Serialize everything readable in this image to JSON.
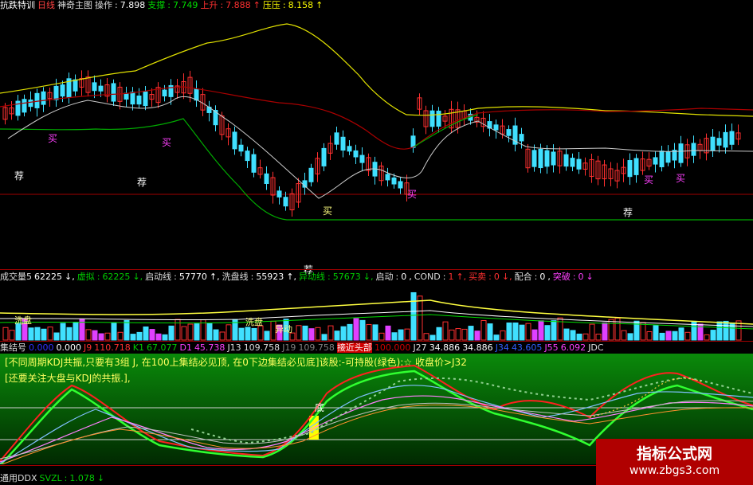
{
  "top": {
    "name": "抗跌特训",
    "period": "日线",
    "formula": "神奇主图",
    "op_label": "操作",
    "op_value": "7.898",
    "support_label": "支撑",
    "support_value": "7.749",
    "rise_label": "上升",
    "rise_value": "7.888",
    "press_label": "压压",
    "press_value": "8.158"
  },
  "vol": {
    "name": "成交量5",
    "vol": "62225",
    "ma_label": "虚拟",
    "ma_value": "62225",
    "start_label": "启动线",
    "start_value": "57770",
    "wash_label": "洗盘线",
    "wash_value": "55923",
    "lift_label": "异动线",
    "lift_value": "57673",
    "boot_label": "启动",
    "boot_value": "0",
    "cond_label": "COND",
    "cond_value": "1",
    "buy_label": "买卖",
    "buy_value": "0",
    "match_label": "配合",
    "match_value": "0",
    "break_label": "突破",
    "break_value": "0"
  },
  "kdj": {
    "name": "集结号",
    "v1": "0.000",
    "v2": "0.000",
    "j9": "J9",
    "j9v": "110.718",
    "k1": "K1",
    "k1v": "67.077",
    "d1": "D1",
    "d1v": "45.738",
    "j13": "J13",
    "j13v": "109.758",
    "j19": "J19",
    "j19v": "109.758",
    "top": "接近头部",
    "topv": "100.000",
    "j27": "J27",
    "j27v": "34.886",
    "j27b": "34.886",
    "j34": "J34",
    "j34v": "43.605",
    "j55": "J55",
    "j55v": "6.092",
    "jdc": "JDC"
  },
  "notes": {
    "line1": "[不同周期KDJ共振,只要有3组 J, 在100上集结必见顶, 在0下边集结必见底]该股:-可持股(绿色):☆ 收盘价>J32",
    "line2": "[还要关注大盘与KDJ的共振.],"
  },
  "labels": {
    "jian": "荐",
    "mai": "买",
    "di": "底",
    "xipan": "洗盘",
    "xipan2": "洗盘",
    "yidong": "异动"
  },
  "bottom": {
    "name": "通用DDX",
    "k": "SVZL",
    "v": "1.078"
  },
  "watermark": {
    "name": "指标公式网",
    "url": "www.zbgs3.com"
  }
}
